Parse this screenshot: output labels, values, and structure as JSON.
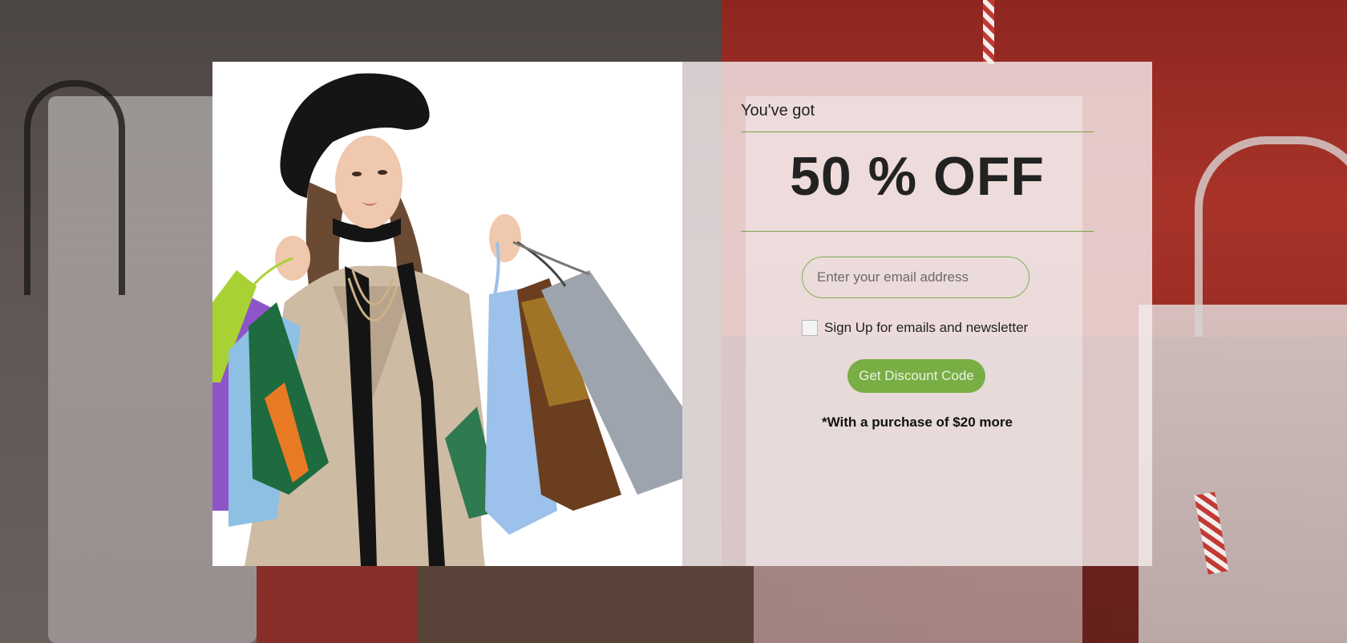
{
  "modal": {
    "intro": "You've got",
    "headline": "50 % OFF",
    "email": {
      "value": "",
      "placeholder": "Enter your email address"
    },
    "signup_label": "Sign Up for emails and newsletter",
    "signup_checked": false,
    "cta_label": "Get Discount Code",
    "note": "*With a purchase of $20 more"
  },
  "colors": {
    "accent": "#79ae45",
    "divider": "#7aa24a",
    "text": "#222222"
  },
  "icons": {
    "photo": "woman-with-shopping-bags-photo",
    "background": "shopping-bags-background-photo"
  }
}
